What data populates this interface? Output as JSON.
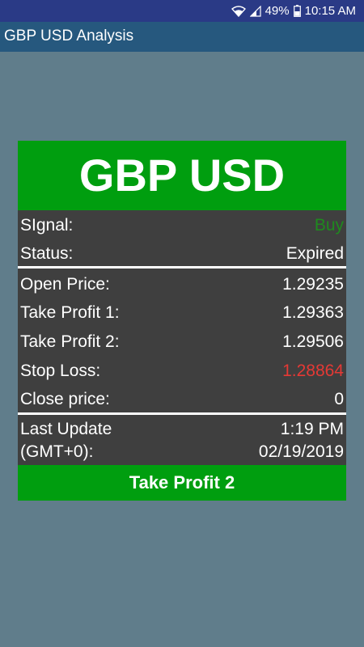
{
  "status_bar": {
    "battery": "49%",
    "time": "10:15 AM",
    "icons": [
      "wifi-icon",
      "signal-icon",
      "battery-icon"
    ]
  },
  "app_bar": {
    "title": "GBP USD Analysis"
  },
  "card": {
    "pair": "GBP USD",
    "rows": {
      "signal": {
        "label": "SIgnal:",
        "value": "Buy"
      },
      "status": {
        "label": "Status:",
        "value": "Expired"
      },
      "open_price": {
        "label": "Open Price:",
        "value": "1.29235"
      },
      "take_profit_1": {
        "label": "Take Profit 1:",
        "value": "1.29363"
      },
      "take_profit_2": {
        "label": "Take Profit 2:",
        "value": "1.29506"
      },
      "stop_loss": {
        "label": "Stop Loss:",
        "value": "1.28864"
      },
      "close_price": {
        "label": "Close price:",
        "value": "0"
      }
    },
    "last_update": {
      "label_line1": "Last Update",
      "label_line2": "(GMT+0):",
      "time": "1:19 PM",
      "date": "02/19/2019"
    },
    "result": "Take Profit 2"
  },
  "colors": {
    "header_green": "#009e0f",
    "card_bg": "#3f3f3f",
    "page_bg": "#607d8b",
    "app_bar": "#26587e",
    "status_bar": "#2a3a86",
    "buy_green": "#1e8a1e",
    "stop_loss_red": "#e53935"
  }
}
